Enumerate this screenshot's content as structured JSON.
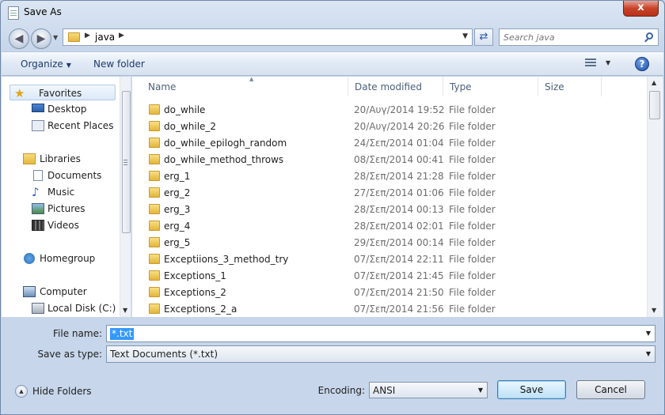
{
  "window": {
    "title": "Save As",
    "close_glyph": "x"
  },
  "address": {
    "crumb": "java",
    "search_placeholder": "Search java"
  },
  "toolbar": {
    "organize": "Organize",
    "new_folder": "New folder"
  },
  "nav": {
    "items": [
      {
        "label": "Favorites",
        "icon": "star-icon"
      },
      {
        "label": "Desktop",
        "icon": "desktop-icon"
      },
      {
        "label": "Recent Places",
        "icon": "recent-places-icon"
      },
      {
        "label": "Libraries",
        "icon": "libraries-icon"
      },
      {
        "label": "Documents",
        "icon": "documents-icon"
      },
      {
        "label": "Music",
        "icon": "music-icon"
      },
      {
        "label": "Pictures",
        "icon": "pictures-icon"
      },
      {
        "label": "Videos",
        "icon": "videos-icon"
      },
      {
        "label": "Homegroup",
        "icon": "homegroup-icon"
      },
      {
        "label": "Computer",
        "icon": "computer-icon"
      },
      {
        "label": "Local Disk (C:)",
        "icon": "disk-icon"
      }
    ]
  },
  "list": {
    "columns": [
      "Name",
      "Date modified",
      "Type",
      "Size"
    ],
    "rows": [
      {
        "name": "do_while",
        "date": "20/Αυγ/2014 19:52",
        "type": "File folder"
      },
      {
        "name": "do_while_2",
        "date": "20/Αυγ/2014 20:26",
        "type": "File folder"
      },
      {
        "name": "do_while_epilogh_random",
        "date": "24/Σεπ/2014 01:04",
        "type": "File folder"
      },
      {
        "name": "do_while_method_throws",
        "date": "08/Σεπ/2014 00:41",
        "type": "File folder"
      },
      {
        "name": "erg_1",
        "date": "28/Σεπ/2014 21:28",
        "type": "File folder"
      },
      {
        "name": "erg_2",
        "date": "27/Σεπ/2014 01:06",
        "type": "File folder"
      },
      {
        "name": "erg_3",
        "date": "28/Σεπ/2014 00:13",
        "type": "File folder"
      },
      {
        "name": "erg_4",
        "date": "28/Σεπ/2014 02:01",
        "type": "File folder"
      },
      {
        "name": "erg_5",
        "date": "29/Σεπ/2014 00:14",
        "type": "File folder"
      },
      {
        "name": "Exceptiions_3_method_try",
        "date": "07/Σεπ/2014 22:11",
        "type": "File folder"
      },
      {
        "name": "Exceptions_1",
        "date": "07/Σεπ/2014 21:45",
        "type": "File folder"
      },
      {
        "name": "Exceptions_2",
        "date": "07/Σεπ/2014 21:50",
        "type": "File folder"
      },
      {
        "name": "Exceptions_2_a",
        "date": "07/Σεπ/2014 21:56",
        "type": "File folder"
      }
    ]
  },
  "form": {
    "file_name_label": "File name:",
    "file_name_value": "*.txt",
    "save_type_label": "Save as type:",
    "save_type_value": "Text Documents (*.txt)",
    "hide_folders": "Hide Folders",
    "encoding_label": "Encoding:",
    "encoding_value": "ANSI",
    "save": "Save",
    "cancel": "Cancel"
  }
}
